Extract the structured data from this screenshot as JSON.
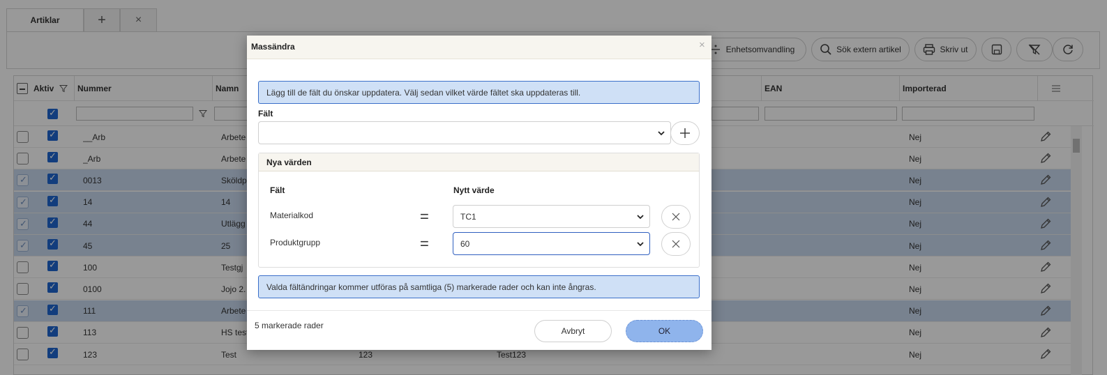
{
  "tabs": {
    "active": "Artiklar",
    "plus": "+",
    "close": "×"
  },
  "toolbar": {
    "unit_conversion": "Enhetsomvandling",
    "search_external": "Sök extern artikel",
    "print": "Skriv ut"
  },
  "grid": {
    "columns": {
      "active": "Aktiv",
      "number": "Nummer",
      "name": "Namn",
      "ean": "EAN",
      "imported": "Importerad"
    },
    "rows": [
      {
        "number": "__Arb",
        "name": "Arbete",
        "col3": "",
        "col4": "",
        "imported": "Nej",
        "selected": false
      },
      {
        "number": "_Arb",
        "name": "Arbete",
        "col3": "",
        "col4": "",
        "imported": "Nej",
        "selected": false
      },
      {
        "number": "0013",
        "name": "Sköldp",
        "col3": "",
        "col4": "",
        "imported": "Nej",
        "selected": true
      },
      {
        "number": "14",
        "name": "14",
        "col3": "",
        "col4": "",
        "imported": "Nej",
        "selected": true
      },
      {
        "number": "44",
        "name": "Utlägg",
        "col3": "",
        "col4": "",
        "imported": "Nej",
        "selected": true
      },
      {
        "number": "45",
        "name": "25",
        "col3": "",
        "col4": "",
        "imported": "Nej",
        "selected": true
      },
      {
        "number": "100",
        "name": "Testgj",
        "col3": "",
        "col4": "",
        "imported": "Nej",
        "selected": false
      },
      {
        "number": "0100",
        "name": "Jojo 2.",
        "col3": "",
        "col4": "",
        "imported": "Nej",
        "selected": false
      },
      {
        "number": "111",
        "name": "Arbete",
        "col3": "",
        "col4": "",
        "imported": "Nej",
        "selected": true
      },
      {
        "number": "113",
        "name": "HS test",
        "col3": "",
        "col4": "",
        "imported": "Nej",
        "selected": false
      },
      {
        "number": "123",
        "name": "Test",
        "col3": "123",
        "col4": "Test123",
        "imported": "Nej",
        "selected": false
      }
    ]
  },
  "dialog": {
    "title": "Massändra",
    "close": "×",
    "info_top": "Lägg till de fält du önskar uppdatera. Välj sedan vilket värde fältet ska uppdateras till.",
    "field_label": "Fält",
    "field_value": "",
    "panel_title": "Nya värden",
    "col_field": "Fält",
    "col_new_value": "Nytt värde",
    "equals": "=",
    "changes": [
      {
        "field": "Materialkod",
        "value": "TC1"
      },
      {
        "field": "Produktgrupp",
        "value": "60"
      }
    ],
    "info_bottom": "Valda fältändringar kommer utföras på samtliga (5) markerade rader och kan inte ångras.",
    "footer_count": "5 markerade rader",
    "cancel": "Avbryt",
    "ok": "OK"
  }
}
